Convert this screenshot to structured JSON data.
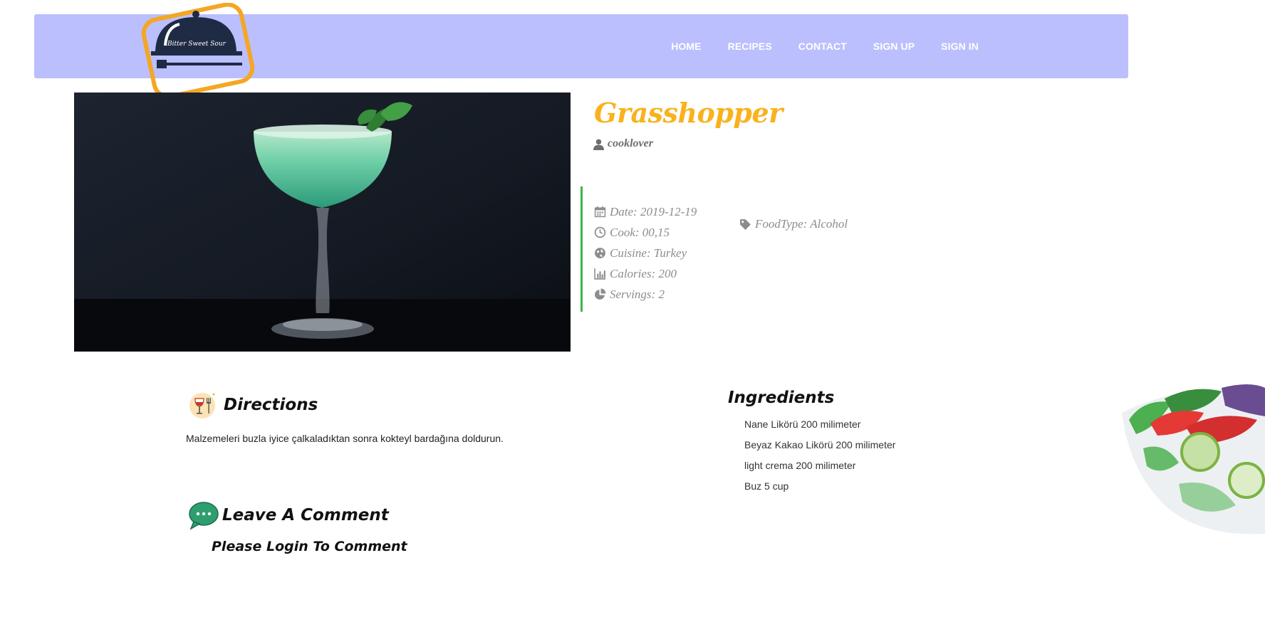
{
  "brand": {
    "logo_text": "Bitter Sweet Sour"
  },
  "nav": {
    "items": [
      {
        "label": "HOME"
      },
      {
        "label": "RECIPES"
      },
      {
        "label": "CONTACT"
      },
      {
        "label": "SIGN UP"
      },
      {
        "label": "SIGN IN"
      }
    ]
  },
  "recipe": {
    "title": "Grasshopper",
    "author": "cooklover",
    "meta": {
      "date": "Date: 2019-12-19",
      "cook": "Cook: 00,15",
      "cuisine": "Cuisine: Turkey",
      "calories": "Calories: 200",
      "servings": "Servings: 2",
      "food_type": "FoodType: Alcohol"
    }
  },
  "directions": {
    "heading": "Directions",
    "text": "Malzemeleri buzla iyice çalkaladıktan sonra kokteyl bardağına doldurun."
  },
  "ingredients": {
    "heading": "Ingredients",
    "items": [
      "Nane Likörü 200 milimeter",
      "Beyaz Kakao Likörü 200 milimeter",
      "light crema 200 milimeter",
      "Buz 5 cup"
    ]
  },
  "comments": {
    "heading": "Leave A Comment",
    "login_message": "Please Login To Comment"
  },
  "colors": {
    "navbar": "#bbbffd",
    "title": "#f9b21d",
    "accent_bar": "#3ab54a",
    "logo_border": "#f5a623"
  },
  "icons": {
    "author": "user-icon",
    "date": "calendar-icon",
    "cook": "clock-icon",
    "cuisine": "globe-icon",
    "calories": "bar-chart-icon",
    "servings": "pie-chart-icon",
    "food_type": "tag-icon",
    "directions": "wine-fork-icon",
    "comments": "speech-bubble-icon"
  }
}
